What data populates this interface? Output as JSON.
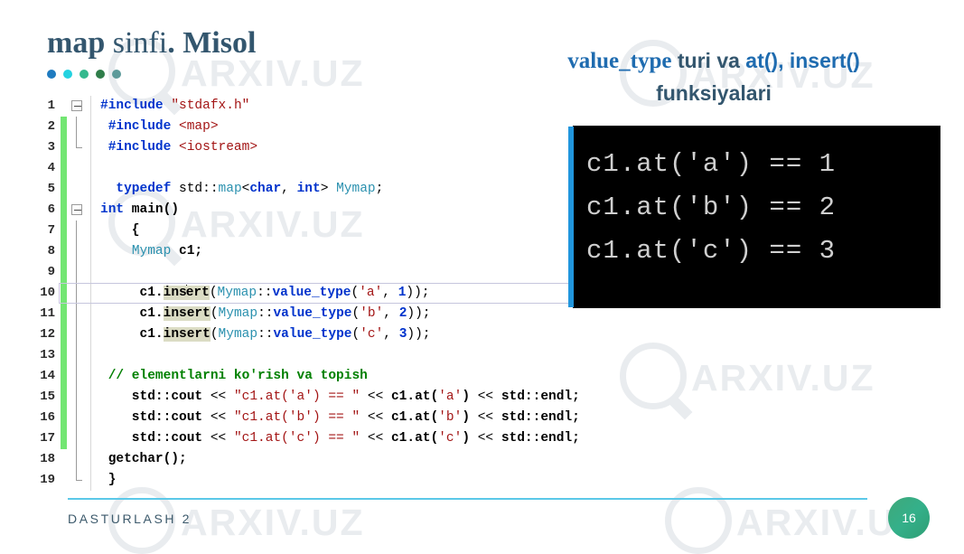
{
  "slide": {
    "title_parts": [
      {
        "text": "map",
        "style": "bold"
      },
      {
        "text": " sinfi",
        "style": "normal"
      },
      {
        "text": ". ",
        "style": "bold"
      },
      {
        "text": "Misol",
        "style": "bold"
      }
    ],
    "title_plain": "map sinfi. Misol",
    "dots": [
      "#1f7bc0",
      "#24d2e0",
      "#35b98e",
      "#2f7d4a",
      "#5d9a9a"
    ],
    "accent_color": "#33566e",
    "link_color": "#1f6cb0",
    "page_number": "16",
    "footer_label": "DASTURLASH 2",
    "watermark_text": "ARXIV.UZ"
  },
  "heading": {
    "line1": [
      {
        "text": "value_type",
        "kind": "serif-blue"
      },
      {
        "text": " turi va ",
        "kind": "sans-dark"
      },
      {
        "text": "at(), insert()",
        "kind": "sans-blue"
      }
    ],
    "line2": "funksiyalari",
    "plain": "value_type turi va at(), insert() funksiyalari"
  },
  "editor": {
    "current_line": 10,
    "lines": [
      {
        "n": "1",
        "changed": false,
        "fold": "open-top",
        "tokens": [
          {
            "t": "#include ",
            "c": "t-pre"
          },
          {
            "t": "\"stdafx.h\"",
            "c": "t-str"
          }
        ]
      },
      {
        "n": "2",
        "changed": true,
        "fold": "line",
        "tokens": [
          {
            "t": " #include ",
            "c": "t-pre"
          },
          {
            "t": "<map>",
            "c": "t-str"
          }
        ]
      },
      {
        "n": "3",
        "changed": true,
        "fold": "elbow",
        "tokens": [
          {
            "t": " #include ",
            "c": "t-pre"
          },
          {
            "t": "<iostream>",
            "c": "t-str"
          }
        ]
      },
      {
        "n": "4",
        "changed": true,
        "fold": "none",
        "tokens": []
      },
      {
        "n": "5",
        "changed": true,
        "fold": "none",
        "tokens": [
          {
            "t": "  ",
            "c": "t-pun"
          },
          {
            "t": "typedef",
            "c": "t-kw"
          },
          {
            "t": " std::",
            "c": "t-pun"
          },
          {
            "t": "map",
            "c": "t-type"
          },
          {
            "t": "<",
            "c": "t-pun"
          },
          {
            "t": "char",
            "c": "t-kw"
          },
          {
            "t": ", ",
            "c": "t-pun"
          },
          {
            "t": "int",
            "c": "t-kw"
          },
          {
            "t": "> ",
            "c": "t-pun"
          },
          {
            "t": "Mymap",
            "c": "t-type"
          },
          {
            "t": ";",
            "c": "t-pun"
          }
        ]
      },
      {
        "n": "6",
        "changed": true,
        "fold": "open-mid",
        "tokens": [
          {
            "t": "int",
            "c": "t-kw"
          },
          {
            "t": " main()",
            "c": "t-id"
          }
        ]
      },
      {
        "n": "7",
        "changed": true,
        "fold": "line",
        "tokens": [
          {
            "t": "    {",
            "c": "t-id"
          }
        ]
      },
      {
        "n": "8",
        "changed": true,
        "fold": "line",
        "tokens": [
          {
            "t": "    ",
            "c": "t-pun"
          },
          {
            "t": "Mymap",
            "c": "t-type"
          },
          {
            "t": " c1;",
            "c": "t-id"
          }
        ]
      },
      {
        "n": "9",
        "changed": true,
        "fold": "line",
        "tokens": []
      },
      {
        "n": "10",
        "changed": true,
        "fold": "line",
        "tokens": [
          {
            "t": "     c1.",
            "c": "t-id"
          },
          {
            "t": "ins",
            "c": "t-id",
            "hl": true
          },
          {
            "t": "CARET",
            "c": "caret"
          },
          {
            "t": "ert",
            "c": "t-id",
            "hl": true
          },
          {
            "t": "(",
            "c": "t-pun"
          },
          {
            "t": "Mymap",
            "c": "t-type"
          },
          {
            "t": "::",
            "c": "t-pun"
          },
          {
            "t": "value_type",
            "c": "t-kw"
          },
          {
            "t": "(",
            "c": "t-pun"
          },
          {
            "t": "'a'",
            "c": "t-str"
          },
          {
            "t": ", ",
            "c": "t-pun"
          },
          {
            "t": "1",
            "c": "t-kw"
          },
          {
            "t": "));",
            "c": "t-pun"
          }
        ]
      },
      {
        "n": "11",
        "changed": true,
        "fold": "line",
        "tokens": [
          {
            "t": "     c1.",
            "c": "t-id"
          },
          {
            "t": "insert",
            "c": "t-id",
            "hl": true
          },
          {
            "t": "(",
            "c": "t-pun"
          },
          {
            "t": "Mymap",
            "c": "t-type"
          },
          {
            "t": "::",
            "c": "t-pun"
          },
          {
            "t": "value_type",
            "c": "t-kw"
          },
          {
            "t": "(",
            "c": "t-pun"
          },
          {
            "t": "'b'",
            "c": "t-str"
          },
          {
            "t": ", ",
            "c": "t-pun"
          },
          {
            "t": "2",
            "c": "t-kw"
          },
          {
            "t": "));",
            "c": "t-pun"
          }
        ]
      },
      {
        "n": "12",
        "changed": true,
        "fold": "line",
        "tokens": [
          {
            "t": "     c1.",
            "c": "t-id"
          },
          {
            "t": "insert",
            "c": "t-id",
            "hl": true
          },
          {
            "t": "(",
            "c": "t-pun"
          },
          {
            "t": "Mymap",
            "c": "t-type"
          },
          {
            "t": "::",
            "c": "t-pun"
          },
          {
            "t": "value_type",
            "c": "t-kw"
          },
          {
            "t": "(",
            "c": "t-pun"
          },
          {
            "t": "'c'",
            "c": "t-str"
          },
          {
            "t": ", ",
            "c": "t-pun"
          },
          {
            "t": "3",
            "c": "t-kw"
          },
          {
            "t": "));",
            "c": "t-pun"
          }
        ]
      },
      {
        "n": "13",
        "changed": true,
        "fold": "line",
        "tokens": []
      },
      {
        "n": "14",
        "changed": true,
        "fold": "line",
        "tokens": [
          {
            "t": " // elementlarni ko'rish va topish",
            "c": "t-cmt"
          }
        ]
      },
      {
        "n": "15",
        "changed": true,
        "fold": "line",
        "tokens": [
          {
            "t": "    std::cout",
            "c": "t-id"
          },
          {
            "t": " << ",
            "c": "t-pun"
          },
          {
            "t": "\"c1.at('a') == \"",
            "c": "t-str"
          },
          {
            "t": " << ",
            "c": "t-pun"
          },
          {
            "t": "c1.at(",
            "c": "t-id"
          },
          {
            "t": "'a'",
            "c": "t-str"
          },
          {
            "t": ")",
            "c": "t-id"
          },
          {
            "t": " << ",
            "c": "t-pun"
          },
          {
            "t": "std::endl;",
            "c": "t-id"
          }
        ]
      },
      {
        "n": "16",
        "changed": true,
        "fold": "line",
        "tokens": [
          {
            "t": "    std::cout",
            "c": "t-id"
          },
          {
            "t": " << ",
            "c": "t-pun"
          },
          {
            "t": "\"c1.at('b') == \"",
            "c": "t-str"
          },
          {
            "t": " << ",
            "c": "t-pun"
          },
          {
            "t": "c1.at(",
            "c": "t-id"
          },
          {
            "t": "'b'",
            "c": "t-str"
          },
          {
            "t": ")",
            "c": "t-id"
          },
          {
            "t": " << ",
            "c": "t-pun"
          },
          {
            "t": "std::endl;",
            "c": "t-id"
          }
        ]
      },
      {
        "n": "17",
        "changed": true,
        "fold": "line",
        "tokens": [
          {
            "t": "    std::cout",
            "c": "t-id"
          },
          {
            "t": " << ",
            "c": "t-pun"
          },
          {
            "t": "\"c1.at('c') == \"",
            "c": "t-str"
          },
          {
            "t": " << ",
            "c": "t-pun"
          },
          {
            "t": "c1.at(",
            "c": "t-id"
          },
          {
            "t": "'c'",
            "c": "t-str"
          },
          {
            "t": ")",
            "c": "t-id"
          },
          {
            "t": " << ",
            "c": "t-pun"
          },
          {
            "t": "std::endl;",
            "c": "t-id"
          }
        ]
      },
      {
        "n": "18",
        "changed": false,
        "fold": "line",
        "tokens": [
          {
            "t": " getchar();",
            "c": "t-id"
          }
        ]
      },
      {
        "n": "19",
        "changed": false,
        "fold": "elbow",
        "tokens": [
          {
            "t": " }",
            "c": "t-id"
          }
        ]
      }
    ]
  },
  "console": {
    "lines": [
      "c1.at('a') == 1",
      "c1.at('b') == 2",
      "c1.at('c') == 3"
    ]
  }
}
